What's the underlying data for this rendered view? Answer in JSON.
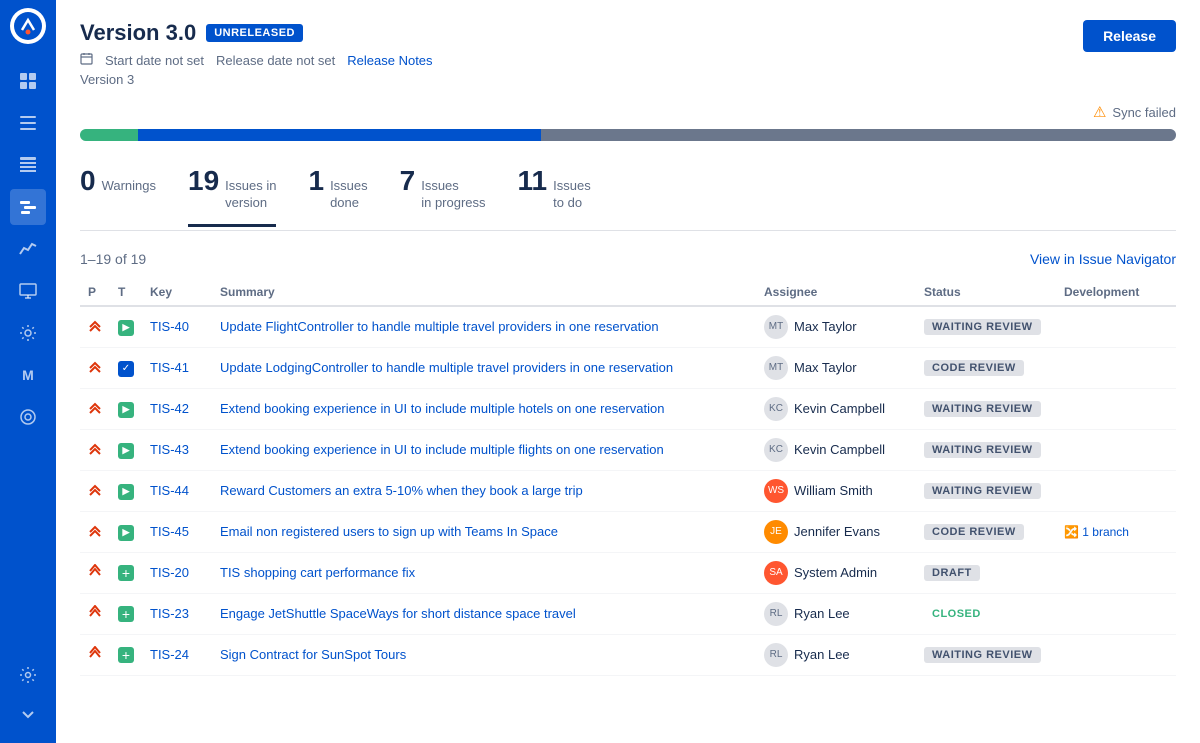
{
  "sidebar": {
    "icons": [
      {
        "name": "board-icon",
        "symbol": "⊞",
        "active": false
      },
      {
        "name": "list-icon",
        "symbol": "☰",
        "active": false
      },
      {
        "name": "table-icon",
        "symbol": "⊟",
        "active": false
      },
      {
        "name": "roadmap-icon",
        "symbol": "📋",
        "active": true
      },
      {
        "name": "chart-icon",
        "symbol": "📈",
        "active": false
      },
      {
        "name": "report-icon",
        "symbol": "🖥",
        "active": false
      },
      {
        "name": "settings-icon",
        "symbol": "⚙",
        "active": false
      },
      {
        "name": "module-icon",
        "symbol": "M",
        "active": false
      },
      {
        "name": "plugin-icon",
        "symbol": "◎",
        "active": false
      }
    ],
    "bottom_icons": [
      {
        "name": "gear-icon",
        "symbol": "⚙"
      },
      {
        "name": "expand-icon",
        "symbol": "»"
      }
    ]
  },
  "header": {
    "version_name": "Version 3.0",
    "badge": "UNRELEASED",
    "start_date": "Start date not set",
    "release_date": "Release date not set",
    "release_notes": "Release Notes",
    "version_sub": "Version 3",
    "release_button": "Release"
  },
  "sync": {
    "message": "Sync failed"
  },
  "progress": {
    "done_pct": 5.26,
    "inprogress_pct": 36.84,
    "remaining_pct": 57.89
  },
  "stats": [
    {
      "number": "0",
      "label": "Warnings",
      "active": false
    },
    {
      "number": "19",
      "label": "Issues in\nversion",
      "active": true
    },
    {
      "number": "1",
      "label": "Issues\ndone",
      "active": false
    },
    {
      "number": "7",
      "label": "Issues\nin progress",
      "active": false
    },
    {
      "number": "11",
      "label": "Issues\nto do",
      "active": false
    }
  ],
  "table": {
    "count_label": "1–19 of 19",
    "view_navigator": "View in Issue Navigator",
    "columns": [
      "P",
      "T",
      "Key",
      "Summary",
      "Assignee",
      "Status",
      "Development"
    ],
    "rows": [
      {
        "priority": "high",
        "priority_icon": "▲",
        "type": "story",
        "type_icon": "▶",
        "key": "TIS-40",
        "summary": "Update FlightController to handle multiple travel providers in one reservation",
        "assignee": "Max Taylor",
        "assignee_type": "gray",
        "status": "WAITING REVIEW",
        "status_type": "waiting",
        "dev": ""
      },
      {
        "priority": "high",
        "priority_icon": "▲",
        "type": "task",
        "type_icon": "✓",
        "key": "TIS-41",
        "summary": "Update LodgingController to handle multiple travel providers in one reservation",
        "assignee": "Max Taylor",
        "assignee_type": "gray",
        "status": "CODE REVIEW",
        "status_type": "code-review",
        "dev": ""
      },
      {
        "priority": "high",
        "priority_icon": "▲",
        "type": "story",
        "type_icon": "▶",
        "key": "TIS-42",
        "summary": "Extend booking experience in UI to include multiple hotels on one reservation",
        "assignee": "Kevin Campbell",
        "assignee_type": "gray",
        "status": "WAITING REVIEW",
        "status_type": "waiting",
        "dev": ""
      },
      {
        "priority": "high",
        "priority_icon": "▲",
        "type": "story",
        "type_icon": "▶",
        "key": "TIS-43",
        "summary": "Extend booking experience in UI to include multiple flights on one reservation",
        "assignee": "Kevin Campbell",
        "assignee_type": "gray",
        "status": "WAITING REVIEW",
        "status_type": "waiting",
        "dev": ""
      },
      {
        "priority": "high",
        "priority_icon": "▲",
        "type": "story",
        "type_icon": "▶",
        "key": "TIS-44",
        "summary": "Reward Customers an extra 5-10% when they book a large trip",
        "assignee": "William Smith",
        "assignee_type": "william",
        "status": "WAITING REVIEW",
        "status_type": "waiting",
        "dev": ""
      },
      {
        "priority": "high",
        "priority_icon": "▲",
        "type": "story",
        "type_icon": "▶",
        "key": "TIS-45",
        "summary": "Email non registered users to sign up with Teams In Space",
        "assignee": "Jennifer Evans",
        "assignee_type": "jennifer",
        "status": "CODE REVIEW",
        "status_type": "code-review",
        "dev": "1 branch"
      },
      {
        "priority": "medium",
        "priority_icon": "⬆",
        "type": "plus",
        "type_icon": "+",
        "key": "TIS-20",
        "summary": "TIS shopping cart performance fix",
        "assignee": "System Admin",
        "assignee_type": "system",
        "status": "DRAFT",
        "status_type": "draft",
        "dev": ""
      },
      {
        "priority": "medium",
        "priority_icon": "⬆",
        "type": "plus",
        "type_icon": "+",
        "key": "TIS-23",
        "summary": "Engage JetShuttle SpaceWays for short distance space travel",
        "assignee": "Ryan Lee",
        "assignee_type": "gray",
        "status": "CLOSED",
        "status_type": "closed",
        "dev": ""
      },
      {
        "priority": "medium",
        "priority_icon": "⬆",
        "type": "plus",
        "type_icon": "+",
        "key": "TIS-24",
        "summary": "Sign Contract for SunSpot Tours",
        "assignee": "Ryan Lee",
        "assignee_type": "gray",
        "status": "WAITING REVIEW",
        "status_type": "waiting",
        "dev": ""
      }
    ]
  },
  "colors": {
    "accent": "#0052cc",
    "success": "#36b37e",
    "warning": "#ff8b00",
    "danger": "#de350b",
    "text_muted": "#5e6c84"
  }
}
